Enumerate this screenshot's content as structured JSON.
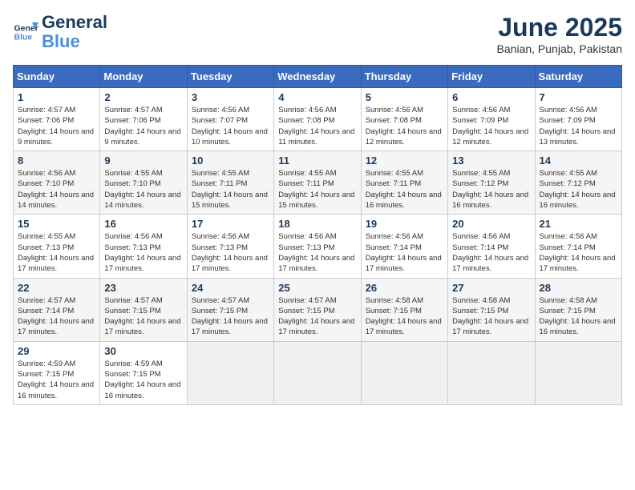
{
  "header": {
    "logo_line1": "General",
    "logo_line2": "Blue",
    "month": "June 2025",
    "location": "Banian, Punjab, Pakistan"
  },
  "weekdays": [
    "Sunday",
    "Monday",
    "Tuesday",
    "Wednesday",
    "Thursday",
    "Friday",
    "Saturday"
  ],
  "weeks": [
    [
      {
        "day": 1,
        "sunrise": "4:57 AM",
        "sunset": "7:06 PM",
        "daylight": "14 hours and 9 minutes."
      },
      {
        "day": 2,
        "sunrise": "4:57 AM",
        "sunset": "7:06 PM",
        "daylight": "14 hours and 9 minutes."
      },
      {
        "day": 3,
        "sunrise": "4:56 AM",
        "sunset": "7:07 PM",
        "daylight": "14 hours and 10 minutes."
      },
      {
        "day": 4,
        "sunrise": "4:56 AM",
        "sunset": "7:08 PM",
        "daylight": "14 hours and 11 minutes."
      },
      {
        "day": 5,
        "sunrise": "4:56 AM",
        "sunset": "7:08 PM",
        "daylight": "14 hours and 12 minutes."
      },
      {
        "day": 6,
        "sunrise": "4:56 AM",
        "sunset": "7:09 PM",
        "daylight": "14 hours and 12 minutes."
      },
      {
        "day": 7,
        "sunrise": "4:56 AM",
        "sunset": "7:09 PM",
        "daylight": "14 hours and 13 minutes."
      }
    ],
    [
      {
        "day": 8,
        "sunrise": "4:56 AM",
        "sunset": "7:10 PM",
        "daylight": "14 hours and 14 minutes."
      },
      {
        "day": 9,
        "sunrise": "4:55 AM",
        "sunset": "7:10 PM",
        "daylight": "14 hours and 14 minutes."
      },
      {
        "day": 10,
        "sunrise": "4:55 AM",
        "sunset": "7:11 PM",
        "daylight": "14 hours and 15 minutes."
      },
      {
        "day": 11,
        "sunrise": "4:55 AM",
        "sunset": "7:11 PM",
        "daylight": "14 hours and 15 minutes."
      },
      {
        "day": 12,
        "sunrise": "4:55 AM",
        "sunset": "7:11 PM",
        "daylight": "14 hours and 16 minutes."
      },
      {
        "day": 13,
        "sunrise": "4:55 AM",
        "sunset": "7:12 PM",
        "daylight": "14 hours and 16 minutes."
      },
      {
        "day": 14,
        "sunrise": "4:55 AM",
        "sunset": "7:12 PM",
        "daylight": "14 hours and 16 minutes."
      }
    ],
    [
      {
        "day": 15,
        "sunrise": "4:55 AM",
        "sunset": "7:13 PM",
        "daylight": "14 hours and 17 minutes."
      },
      {
        "day": 16,
        "sunrise": "4:56 AM",
        "sunset": "7:13 PM",
        "daylight": "14 hours and 17 minutes."
      },
      {
        "day": 17,
        "sunrise": "4:56 AM",
        "sunset": "7:13 PM",
        "daylight": "14 hours and 17 minutes."
      },
      {
        "day": 18,
        "sunrise": "4:56 AM",
        "sunset": "7:13 PM",
        "daylight": "14 hours and 17 minutes."
      },
      {
        "day": 19,
        "sunrise": "4:56 AM",
        "sunset": "7:14 PM",
        "daylight": "14 hours and 17 minutes."
      },
      {
        "day": 20,
        "sunrise": "4:56 AM",
        "sunset": "7:14 PM",
        "daylight": "14 hours and 17 minutes."
      },
      {
        "day": 21,
        "sunrise": "4:56 AM",
        "sunset": "7:14 PM",
        "daylight": "14 hours and 17 minutes."
      }
    ],
    [
      {
        "day": 22,
        "sunrise": "4:57 AM",
        "sunset": "7:14 PM",
        "daylight": "14 hours and 17 minutes."
      },
      {
        "day": 23,
        "sunrise": "4:57 AM",
        "sunset": "7:15 PM",
        "daylight": "14 hours and 17 minutes."
      },
      {
        "day": 24,
        "sunrise": "4:57 AM",
        "sunset": "7:15 PM",
        "daylight": "14 hours and 17 minutes."
      },
      {
        "day": 25,
        "sunrise": "4:57 AM",
        "sunset": "7:15 PM",
        "daylight": "14 hours and 17 minutes."
      },
      {
        "day": 26,
        "sunrise": "4:58 AM",
        "sunset": "7:15 PM",
        "daylight": "14 hours and 17 minutes."
      },
      {
        "day": 27,
        "sunrise": "4:58 AM",
        "sunset": "7:15 PM",
        "daylight": "14 hours and 17 minutes."
      },
      {
        "day": 28,
        "sunrise": "4:58 AM",
        "sunset": "7:15 PM",
        "daylight": "14 hours and 16 minutes."
      }
    ],
    [
      {
        "day": 29,
        "sunrise": "4:59 AM",
        "sunset": "7:15 PM",
        "daylight": "14 hours and 16 minutes."
      },
      {
        "day": 30,
        "sunrise": "4:59 AM",
        "sunset": "7:15 PM",
        "daylight": "14 hours and 16 minutes."
      },
      null,
      null,
      null,
      null,
      null
    ]
  ]
}
